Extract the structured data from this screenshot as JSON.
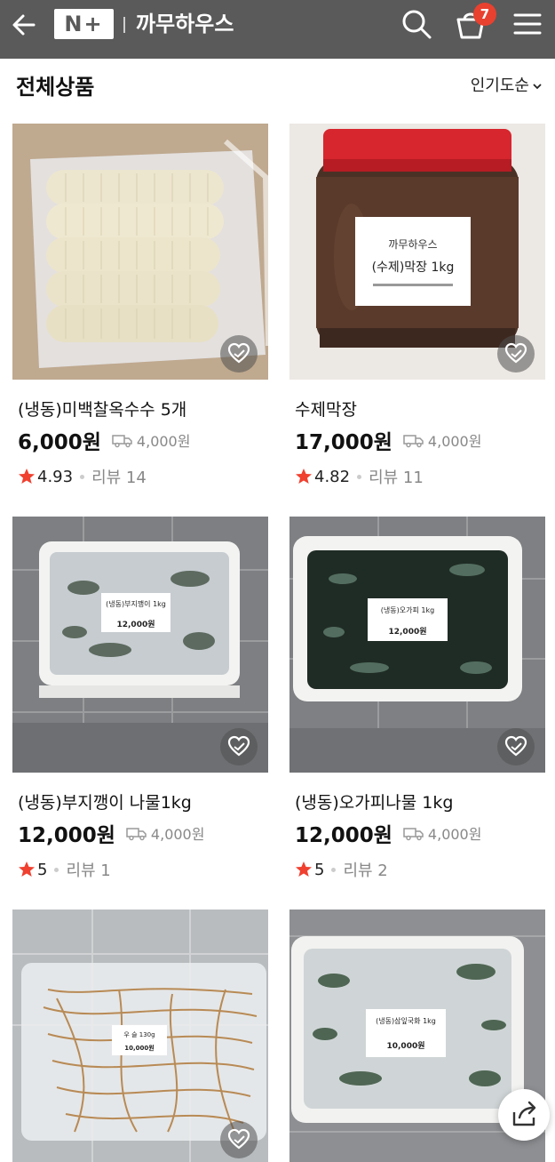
{
  "header": {
    "logo_text": "N+",
    "store_name": "까무하우스",
    "cart_count": "7",
    "icons": [
      "back-arrow-icon",
      "search-icon",
      "cart-icon",
      "menu-icon"
    ],
    "bg_color": "#5a5a5a",
    "badge_color": "#e8412f"
  },
  "section": {
    "title": "전체상품",
    "sort_label": "인기도순"
  },
  "products": [
    {
      "name": "(냉동)미백찰옥수수 5개",
      "price": "6,000원",
      "shipping": "4,000원",
      "rating": "4.93",
      "review": "리뷰 14",
      "image": "corn"
    },
    {
      "name": "수제막장",
      "price": "17,000원",
      "shipping": "4,000원",
      "rating": "4.82",
      "review": "리뷰 11",
      "image": "jar",
      "label_store": "까무하우스",
      "label_product": "(수제)막장 1kg"
    },
    {
      "name": "(냉동)부지깽이 나물1kg",
      "price": "12,000원",
      "shipping": "4,000원",
      "rating": "5",
      "review": "리뷰 1",
      "image": "greens-light",
      "label_product": "(냉동)부지깽이 1kg",
      "label_price": "12,000원"
    },
    {
      "name": "(냉동)오가피나물 1kg",
      "price": "12,000원",
      "shipping": "4,000원",
      "rating": "5",
      "review": "리뷰 2",
      "image": "greens-dark",
      "label_product": "(냉동)오가피 1kg",
      "label_price": "12,000원"
    },
    {
      "name": "",
      "price": "",
      "shipping": "",
      "rating": "",
      "review": "",
      "image": "roots",
      "label_product": "우 슬 130g",
      "label_price": "10,000원"
    },
    {
      "name": "",
      "price": "",
      "shipping": "",
      "rating": "",
      "review": "",
      "image": "greens-frost",
      "label_product": "(냉동)삼잎국화 1kg",
      "label_price": "10,000원"
    }
  ],
  "accent_star_color": "#f0402f"
}
